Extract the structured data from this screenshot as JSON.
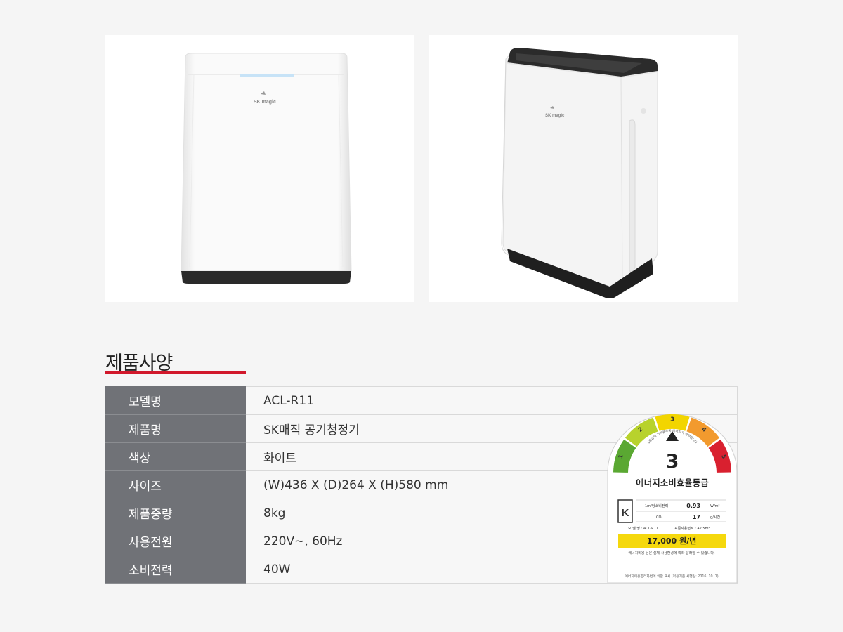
{
  "images": [
    {
      "name": "front",
      "logo_text": "SK magic"
    },
    {
      "name": "angle",
      "logo_text": "SK magic"
    }
  ],
  "section_title": "제품사양",
  "specs": [
    {
      "label": "모델명",
      "value": "ACL-R11"
    },
    {
      "label": "제품명",
      "value": "SK매직 공기청정기"
    },
    {
      "label": "색상",
      "value": "화이트"
    },
    {
      "label": "사이즈",
      "value": "(W)436 X (D)264 X (H)580 mm"
    },
    {
      "label": "제품중량",
      "value": "8kg"
    },
    {
      "label": "사용전원",
      "value": "220V~, 60Hz"
    },
    {
      "label": "소비전력",
      "value": "40W"
    }
  ],
  "energy_label": {
    "grades": [
      "1",
      "2",
      "3",
      "4",
      "5"
    ],
    "grade_colors": [
      "#5aa832",
      "#b8d22c",
      "#f2d500",
      "#f29a2e",
      "#d9202f"
    ],
    "current_grade": "3",
    "arc_caption": "1등급에 가까울수록 에너지가 절약됩니다",
    "title": "에너지소비효율등급",
    "row1_label": "1m²당소비전력",
    "row1_value": "0.93",
    "row1_unit": "W/m²",
    "row2_label": "CO₂",
    "row2_value": "17",
    "row2_unit": "g/시간",
    "model_line": "모 델 명 : ACL-R11",
    "area_line": "표준사용면적 : 42.5m²",
    "annual_cost": "17,000 원/년",
    "note": "에너지비용 등은 실제 사용환경에 따라 달라질 수 있습니다.",
    "footer": "에너지이용합리화법에 의한 표시 (적용기준 시행일: 2016. 10. 1)"
  }
}
